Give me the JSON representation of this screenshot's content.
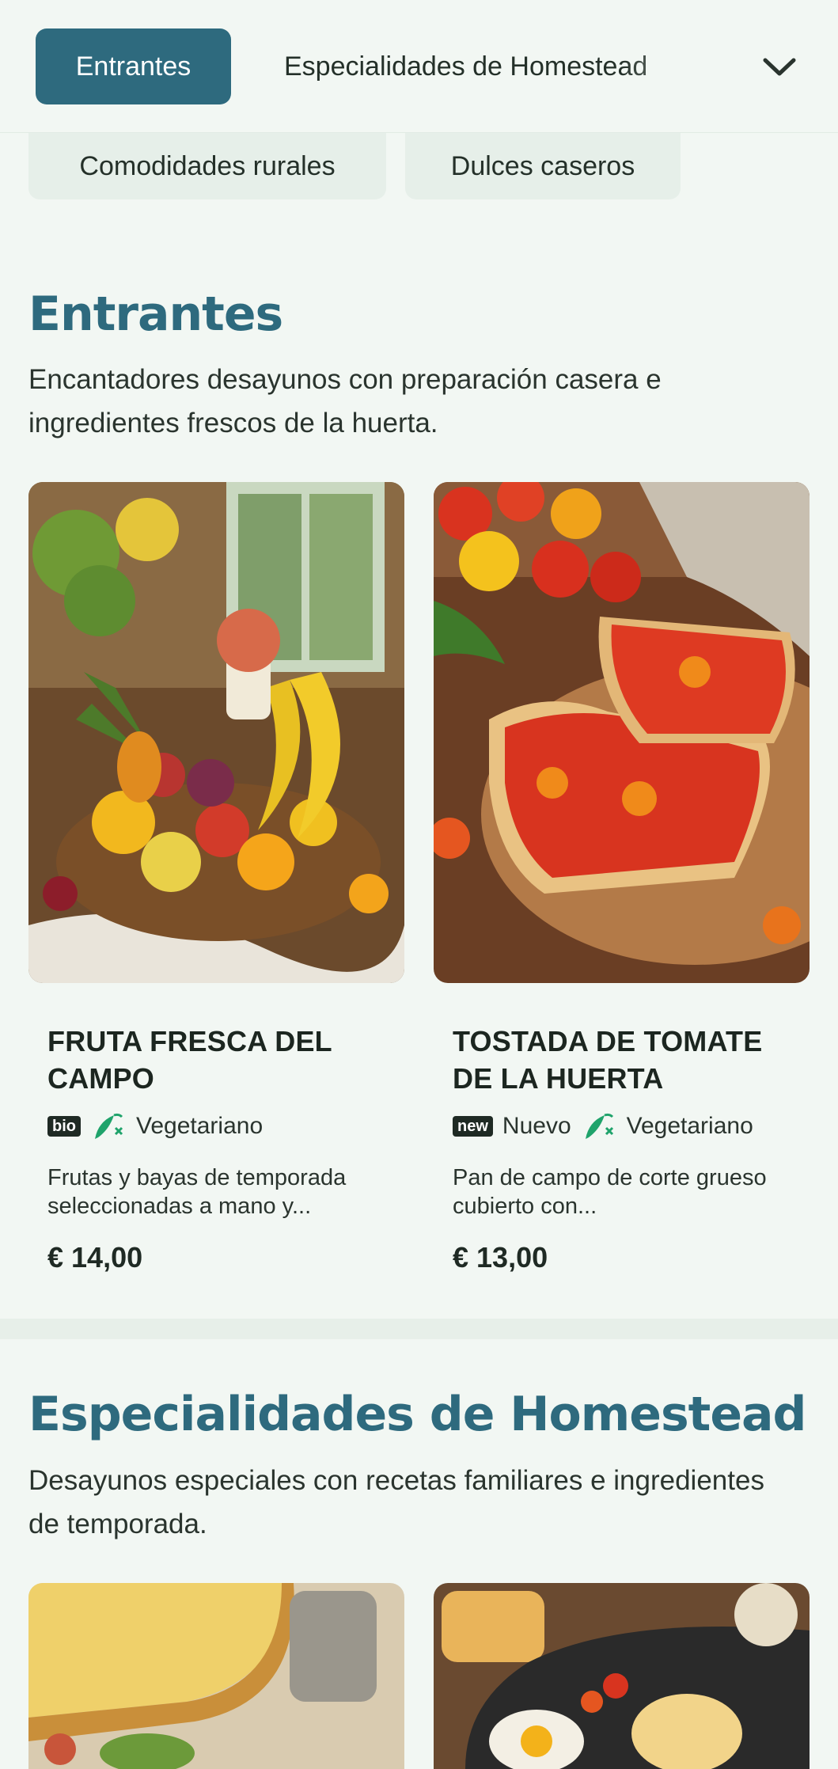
{
  "categories": {
    "active": "Entrantes",
    "second": "Especialidades de Homestead",
    "row2": [
      "Comodidades rurales",
      "Dulces caseros"
    ]
  },
  "sections": [
    {
      "title": "Entrantes",
      "description": "Encantadores desayunos con preparación casera e ingredientes frescos de la huerta.",
      "items": [
        {
          "name": "FRUTA FRESCA DEL CAMPO",
          "badge": "bio",
          "tag": "Vegetariano",
          "description": "Frutas y bayas de temporada seleccionadas a mano y...",
          "price": "€ 14,00"
        },
        {
          "name": "TOSTADA DE TOMATE DE LA HUERTA",
          "badge": "new",
          "badge_label": "Nuevo",
          "tag": "Vegetariano",
          "description": "Pan de campo de corte grueso cubierto con...",
          "price": "€ 13,00"
        }
      ]
    },
    {
      "title": "Especialidades de Homestead",
      "description": "Desayunos especiales con recetas familiares e ingredientes de temporada."
    }
  ],
  "colors": {
    "accent": "#2e6a7e",
    "background": "#f2f7f3",
    "tag_green": "#1fa36b"
  }
}
